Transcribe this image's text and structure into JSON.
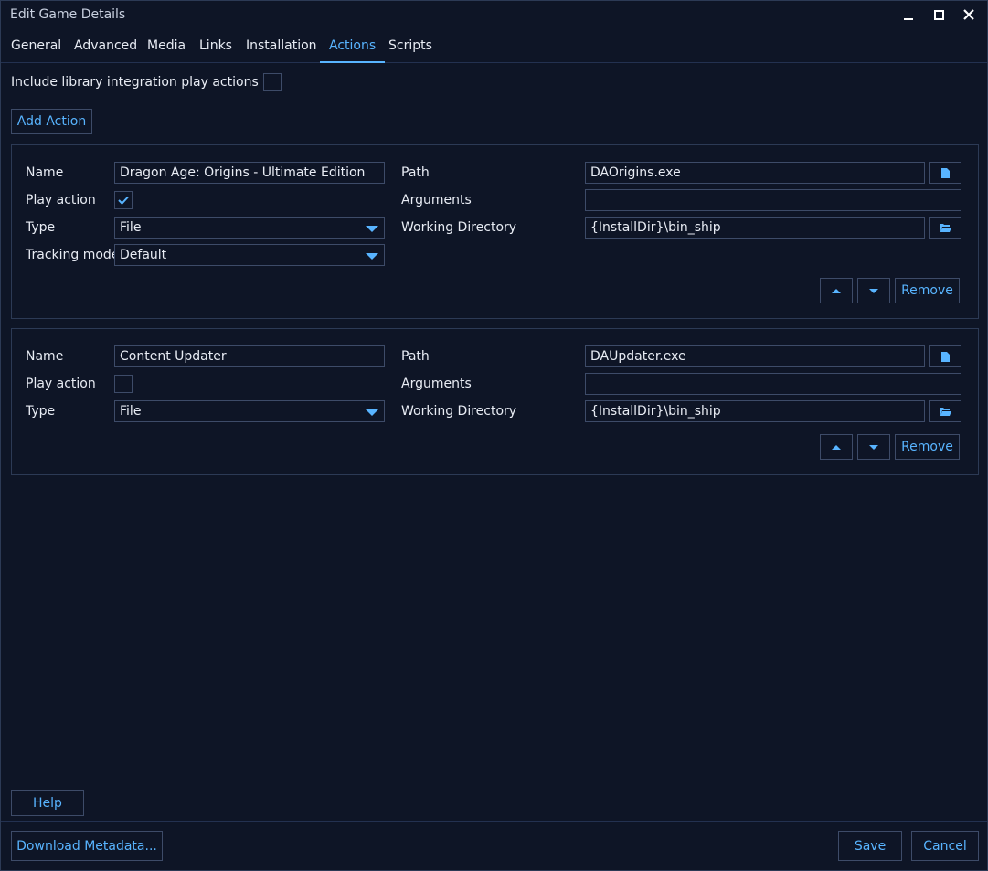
{
  "window": {
    "title": "Edit Game Details"
  },
  "tabs": [
    {
      "label": "General"
    },
    {
      "label": "Advanced"
    },
    {
      "label": "Media"
    },
    {
      "label": "Links"
    },
    {
      "label": "Installation"
    },
    {
      "label": "Actions",
      "active": true
    },
    {
      "label": "Scripts"
    }
  ],
  "include_library": {
    "label": "Include library integration play actions",
    "checked": false
  },
  "add_action_label": "Add Action",
  "labels": {
    "name": "Name",
    "play_action": "Play action",
    "type": "Type",
    "tracking_mode": "Tracking mode",
    "path": "Path",
    "arguments": "Arguments",
    "working_directory": "Working Directory",
    "remove": "Remove"
  },
  "actions": [
    {
      "name": "Dragon Age: Origins - Ultimate Edition",
      "play_action": true,
      "type": "File",
      "tracking_mode": "Default",
      "path": "DAOrigins.exe",
      "arguments": "",
      "working_directory": "{InstallDir}\\bin_ship"
    },
    {
      "name": "Content Updater",
      "play_action": false,
      "type": "File",
      "path": "DAUpdater.exe",
      "arguments": "",
      "working_directory": "{InstallDir}\\bin_ship"
    }
  ],
  "buttons": {
    "help": "Help",
    "download_metadata": "Download Metadata...",
    "save": "Save",
    "cancel": "Cancel"
  },
  "colors": {
    "background": "#0e1526",
    "accent": "#58b4ff",
    "border": "#3d4b68"
  }
}
